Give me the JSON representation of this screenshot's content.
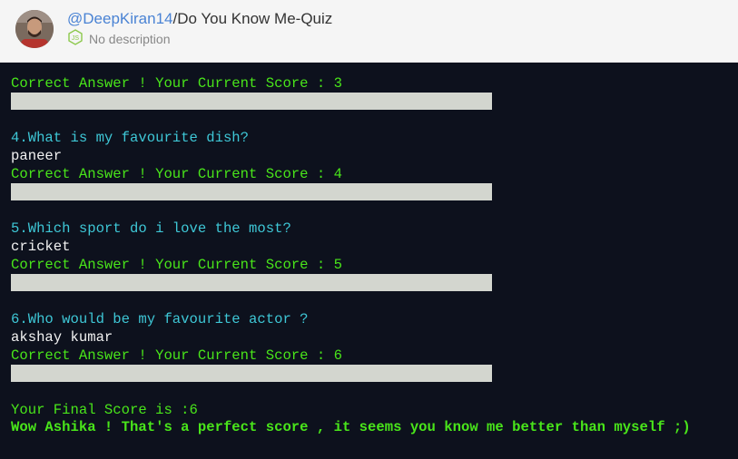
{
  "header": {
    "owner": "@DeepKiran14",
    "separator": "/",
    "repo_name": "Do You Know Me-Quiz",
    "language_icon": "nodejs-icon",
    "description": "No description"
  },
  "console": {
    "lines": {
      "score3": "Correct Answer ! Your Current Score : 3",
      "q4": "4.What is my favourite dish?",
      "a4": "paneer",
      "score4": "Correct Answer ! Your Current Score : 4",
      "q5": "5.Which sport do i love the most?",
      "a5": "cricket",
      "score5": "Correct Answer ! Your Current Score : 5",
      "q6": "6.Who would be my favourite actor ?",
      "a6": "akshay kumar",
      "score6": "Correct Answer ! Your Current Score : 6",
      "final": "Your Final Score is :6",
      "message": "Wow Ashika ! That's a perfect score , it seems you know me better than myself ;)"
    }
  },
  "colors": {
    "console_bg": "#0d111d",
    "score_green": "#49e51a",
    "question_cyan": "#3ec7d6",
    "answer_white": "#f2f2f2",
    "owner_link": "#4a83d4",
    "input_bar": "#d3d6cf"
  }
}
